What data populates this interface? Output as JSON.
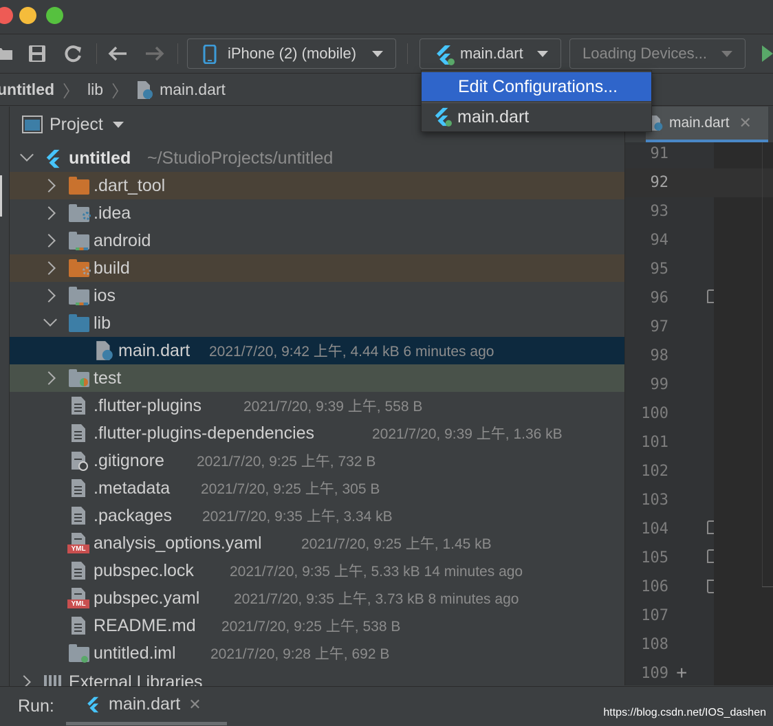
{
  "colors": {
    "accent": "#2f65ca",
    "selected_row": "#0d293e",
    "excluded_row": "#4a4237",
    "test_row": "#49524a",
    "folder_orange": "#c9722e",
    "folder_gray": "#8f9aa3",
    "folder_blue": "#3d7ea6",
    "flutter_blue": "#47c5fb",
    "run_green": "#59a869"
  },
  "toolbar": {
    "device_selector": "iPhone (2) (mobile)",
    "run_config": "main.dart",
    "devices_loading": "Loading Devices..."
  },
  "run_config_menu": {
    "items": [
      "Edit Configurations...",
      "main.dart"
    ]
  },
  "breadcrumb": {
    "items": [
      "untitled",
      "lib",
      "main.dart"
    ]
  },
  "project_panel": {
    "title": "Project",
    "root_name": "untitled",
    "root_path": "~/StudioProjects/untitled",
    "tree": [
      {
        "name": ".dart_tool",
        "meta": "",
        "icon": "folder-excluded-icon"
      },
      {
        "name": ".idea",
        "meta": "",
        "icon": "folder-gear-icon"
      },
      {
        "name": "android",
        "meta": "",
        "icon": "folder-module-icon"
      },
      {
        "name": "build",
        "meta": "",
        "icon": "folder-excluded-icon"
      },
      {
        "name": "ios",
        "meta": "",
        "icon": "folder-module-icon"
      },
      {
        "name": "lib",
        "meta": "",
        "icon": "folder-source-icon"
      },
      {
        "name": "main.dart",
        "meta": "2021/7/20, 9:42 上午, 4.44 kB 6 minutes ago",
        "icon": "dart-file-icon"
      },
      {
        "name": "test",
        "meta": "",
        "icon": "folder-test-icon"
      },
      {
        "name": ".flutter-plugins",
        "meta": "2021/7/20, 9:39 上午, 558 B",
        "icon": "file-icon"
      },
      {
        "name": ".flutter-plugins-dependencies",
        "meta": "2021/7/20, 9:39 上午, 1.36 kB",
        "icon": "file-icon"
      },
      {
        "name": ".gitignore",
        "meta": "2021/7/20, 9:25 上午, 732 B",
        "icon": "ignore-file-icon"
      },
      {
        "name": ".metadata",
        "meta": "2021/7/20, 9:25 上午, 305 B",
        "icon": "file-icon"
      },
      {
        "name": ".packages",
        "meta": "2021/7/20, 9:35 上午, 3.34 kB",
        "icon": "file-icon"
      },
      {
        "name": "analysis_options.yaml",
        "meta": "2021/7/20, 9:25 上午, 1.45 kB",
        "icon": "yaml-file-icon"
      },
      {
        "name": "pubspec.lock",
        "meta": "2021/7/20, 9:35 上午, 5.33 kB 14 minutes ago",
        "icon": "file-icon"
      },
      {
        "name": "pubspec.yaml",
        "meta": "2021/7/20, 9:35 上午, 3.73 kB 8 minutes ago",
        "icon": "yaml-file-icon"
      },
      {
        "name": "README.md",
        "meta": "2021/7/20, 9:25 上午, 538 B",
        "icon": "file-icon"
      },
      {
        "name": "untitled.iml",
        "meta": "2021/7/20, 9:28 上午, 692 B",
        "icon": "module-file-icon"
      }
    ],
    "external_libraries": "External Libraries"
  },
  "editor": {
    "tab_label": "main.dart",
    "line_numbers": [
      "91",
      "92",
      "93",
      "94",
      "95",
      "96",
      "97",
      "98",
      "99",
      "100",
      "101",
      "102",
      "103",
      "104",
      "105",
      "106",
      "107",
      "108",
      "109"
    ],
    "current_line": "92"
  },
  "run_panel": {
    "label": "Run:",
    "tab_label": "main.dart"
  },
  "watermark": "https://blog.csdn.net/IOS_dashen"
}
